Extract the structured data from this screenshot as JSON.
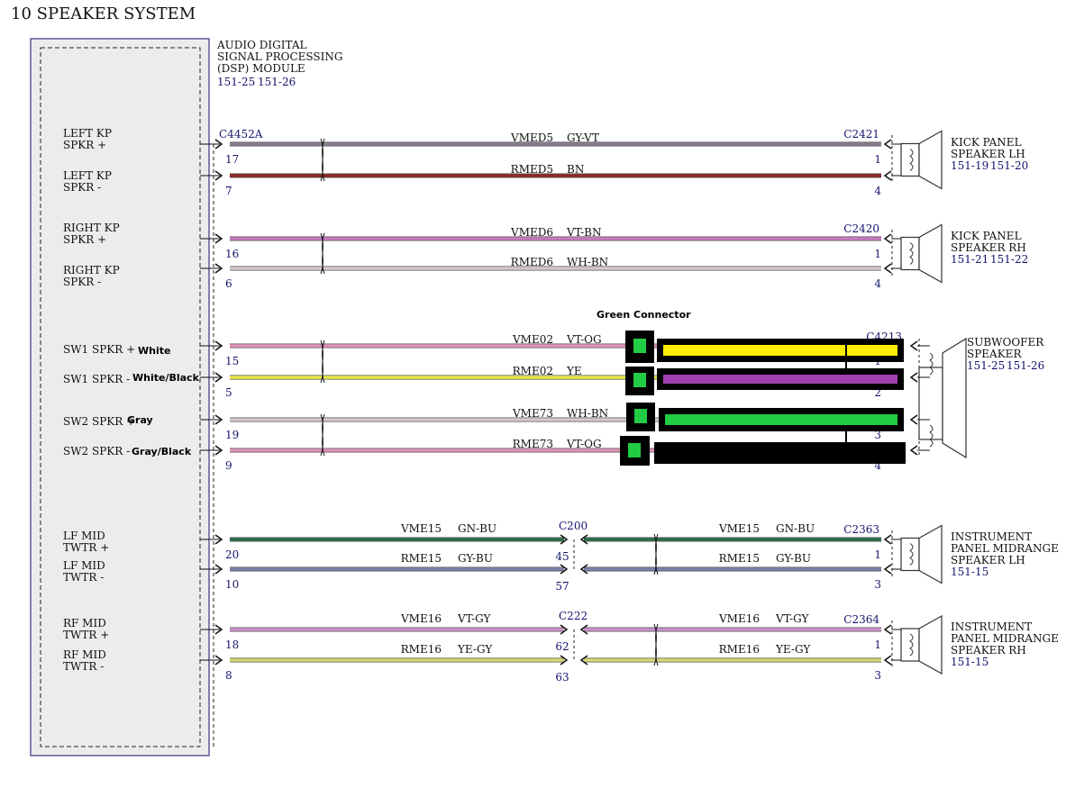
{
  "title": "10 SPEAKER SYSTEM",
  "module": {
    "lines": [
      "AUDIO DIGITAL",
      "SIGNAL PROCESSING",
      "(DSP) MODULE"
    ],
    "refs": [
      "151-25",
      "151-26"
    ],
    "connector": "C4452A"
  },
  "module_labels": [
    [
      "LEFT KP",
      "SPKR +"
    ],
    [
      "LEFT KP",
      "SPKR -"
    ],
    [
      "RIGHT KP",
      "SPKR +"
    ],
    [
      "RIGHT KP",
      "SPKR -"
    ],
    [
      "SW1 SPKR +"
    ],
    [
      "SW1 SPKR -"
    ],
    [
      "SW2 SPKR +"
    ],
    [
      "SW2 SPKR -"
    ],
    [
      "LF MID",
      "TWTR +"
    ],
    [
      "LF MID",
      "TWTR -"
    ],
    [
      "RF MID",
      "TWTR +"
    ],
    [
      "RF MID",
      "TWTR -"
    ]
  ],
  "annotations": {
    "green_connector": "Green Connector",
    "sw1_pos": "White",
    "sw1_neg": "White/Black",
    "sw2_pos": "Gray",
    "sw2_neg": "Gray/Black"
  },
  "circuits": [
    {
      "circuit": "VMED5",
      "color_code": "GY-VT",
      "module_pin": "17",
      "speaker_pin": "1",
      "wire_color": "#8a7d8e"
    },
    {
      "circuit": "RMED5",
      "color_code": "BN",
      "module_pin": "7",
      "speaker_pin": "4",
      "wire_color": "#8b2b22"
    },
    {
      "circuit": "VMED6",
      "color_code": "VT-BN",
      "module_pin": "16",
      "speaker_pin": "1",
      "wire_color": "#c77cc2"
    },
    {
      "circuit": "RMED6",
      "color_code": "WH-BN",
      "module_pin": "6",
      "speaker_pin": "4",
      "wire_color": "#d8c8c8"
    },
    {
      "circuit": "VME02",
      "color_code": "VT-OG",
      "module_pin": "15",
      "speaker_pin": "1",
      "wire_color": "#e092b8"
    },
    {
      "circuit": "RME02",
      "color_code": "YE",
      "module_pin": "5",
      "speaker_pin": "2",
      "wire_color": "#eaea4a"
    },
    {
      "circuit": "VME73",
      "color_code": "WH-BN",
      "module_pin": "19",
      "speaker_pin": "3",
      "wire_color": "#d8c8c8"
    },
    {
      "circuit": "RME73",
      "color_code": "VT-OG",
      "module_pin": "9",
      "speaker_pin": "4",
      "wire_color": "#e092b8"
    },
    {
      "circuit": "VME15",
      "color_code": "GN-BU",
      "module_pin": "20",
      "inline_pin": "45",
      "speaker_pin": "1",
      "wire_color": "#2d6e46"
    },
    {
      "circuit": "RME15",
      "color_code": "GY-BU",
      "module_pin": "10",
      "inline_pin": "57",
      "speaker_pin": "3",
      "wire_color": "#7d80a8"
    },
    {
      "circuit": "VME16",
      "color_code": "VT-GY",
      "module_pin": "18",
      "inline_pin": "62",
      "speaker_pin": "1",
      "wire_color": "#c890c8"
    },
    {
      "circuit": "RME16",
      "color_code": "YE-GY",
      "module_pin": "8",
      "inline_pin": "63",
      "speaker_pin": "3",
      "wire_color": "#d8d870"
    }
  ],
  "inline_connectors": [
    "C200",
    "C222"
  ],
  "speakers": [
    {
      "connector": "C2421",
      "lines": [
        "KICK PANEL",
        "SPEAKER LH"
      ],
      "refs": [
        "151-19",
        "151-20"
      ]
    },
    {
      "connector": "C2420",
      "lines": [
        "KICK PANEL",
        "SPEAKER RH"
      ],
      "refs": [
        "151-21",
        "151-22"
      ]
    },
    {
      "connector": "C4213",
      "lines": [
        "SUBWOOFER",
        "SPEAKER"
      ],
      "refs": [
        "151-25",
        "151-26"
      ]
    },
    {
      "connector": "C2363",
      "lines": [
        "INSTRUMENT",
        "PANEL MIDRANGE",
        "SPEAKER LH"
      ],
      "refs": [
        "151-15"
      ]
    },
    {
      "connector": "C2364",
      "lines": [
        "INSTRUMENT",
        "PANEL MIDRANGE",
        "SPEAKER RH"
      ],
      "refs": [
        "151-15"
      ]
    }
  ],
  "overlay_colors": {
    "black": "#000000",
    "yellow": "#ffee00",
    "purple": "#a040b0",
    "green": "#22cc44"
  }
}
